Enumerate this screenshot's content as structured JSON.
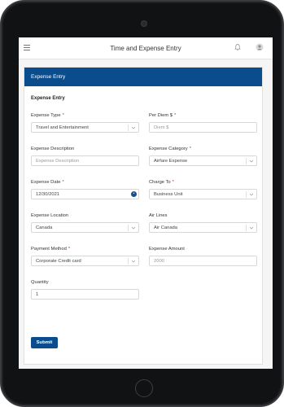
{
  "app": {
    "title": "Time and Expense Entry"
  },
  "card": {
    "header": "Expense Entry",
    "section_title": "Expense Entry"
  },
  "fields": {
    "expense_type": {
      "label": "Expense Type",
      "value": "Travel and Entertainment",
      "required": true
    },
    "per_diem": {
      "label": "Per Diem $",
      "placeholder": "Diem $",
      "required": true
    },
    "description": {
      "label": "Expense Description",
      "placeholder": "Expense Description"
    },
    "category": {
      "label": "Expense Category",
      "value": "Airfare Expense",
      "required": true
    },
    "date": {
      "label": "Expense Date",
      "value": "12/30/2021",
      "required": true
    },
    "charge_to": {
      "label": "Charge To",
      "value": "Business Unit",
      "required": true
    },
    "location": {
      "label": "Expense Location",
      "value": "Canada",
      "marker": "·"
    },
    "air_lines": {
      "label": "Air Lines",
      "value": "Air Canada"
    },
    "payment_method": {
      "label": "Payment Method",
      "value": "Corporate Credit card",
      "required": true
    },
    "amount": {
      "label": "Expense Amount",
      "value": "2000",
      "marker": "·"
    },
    "quantity": {
      "label": "Quantity",
      "value": "1"
    }
  },
  "required_marker": "*",
  "submit_label": "Submit",
  "icons": [
    "menu-icon",
    "bell-icon",
    "user-icon",
    "chevron-down-icon",
    "calendar-icon"
  ],
  "colors": {
    "brand": "#0b4c8c",
    "required": "#c23934"
  }
}
